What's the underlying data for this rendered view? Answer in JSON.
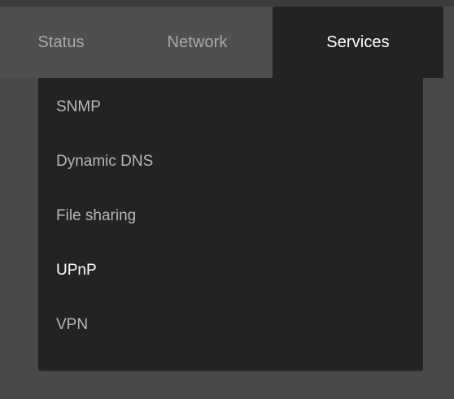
{
  "tabs": [
    {
      "id": "status",
      "label": "Status"
    },
    {
      "id": "network",
      "label": "Network"
    },
    {
      "id": "services",
      "label": "Services",
      "selected": true
    }
  ],
  "menu": {
    "items": [
      {
        "id": "snmp",
        "label": "SNMP"
      },
      {
        "id": "dynamic-dns",
        "label": "Dynamic DNS"
      },
      {
        "id": "file-sharing",
        "label": "File sharing"
      },
      {
        "id": "upnp",
        "label": "UPnP",
        "active": true
      },
      {
        "id": "vpn",
        "label": "VPN"
      }
    ]
  },
  "colors": {
    "background": "#494949",
    "tab_inactive_bg": "#4f4f4f",
    "tab_active_bg": "#232323",
    "menu_bg": "#232323",
    "text_inactive": "#a9a9a9",
    "text_active": "#ffffff"
  }
}
